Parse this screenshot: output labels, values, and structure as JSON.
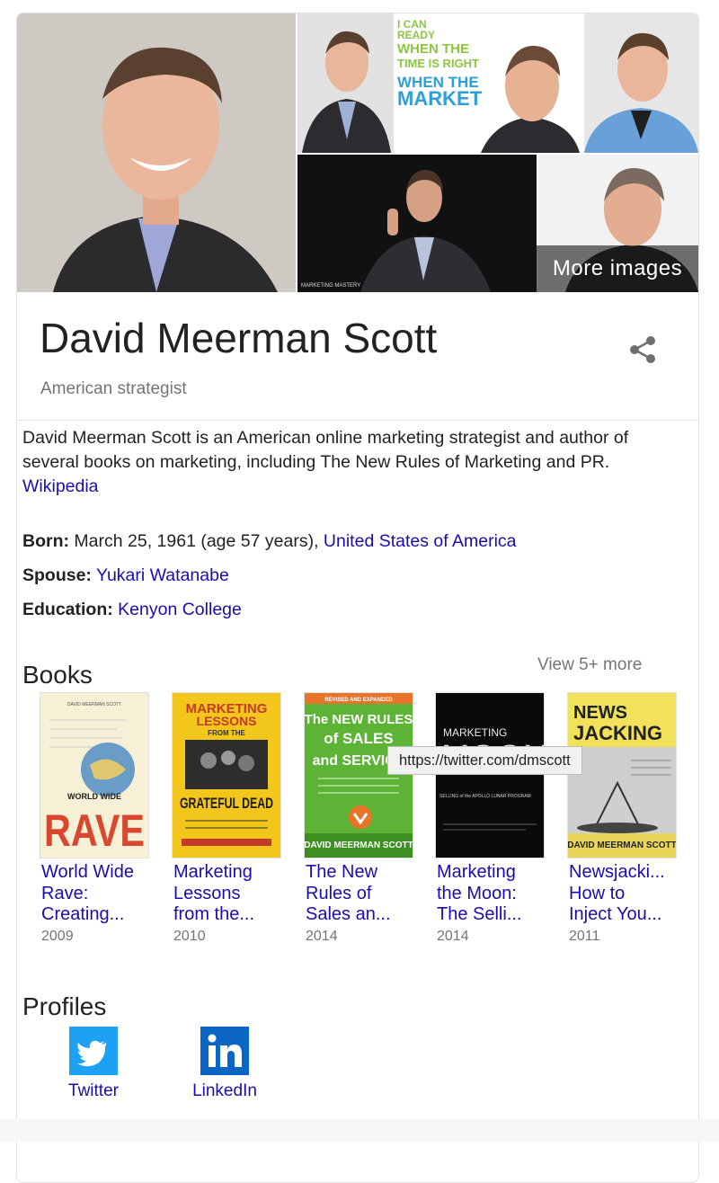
{
  "gallery": {
    "more_images_label": "More images",
    "thumb_text_lines": [
      "I CAN",
      "READY",
      "WHEN THE",
      "TIME IS RIGHT",
      "WHEN THE",
      "MARKET"
    ],
    "thumb_badge": "MARKETING MASTERY"
  },
  "entity": {
    "name": "David Meerman Scott",
    "subtitle": "American strategist"
  },
  "description": {
    "text": "David Meerman Scott is an American online marketing strategist and author of several books on marketing, including The New Rules of Marketing and PR.",
    "source_link": "Wikipedia"
  },
  "facts": {
    "born_label": "Born:",
    "born_value": "March 25, 1961 (age 57 years),",
    "born_place": "United States of America",
    "spouse_label": "Spouse:",
    "spouse_value": "Yukari Watanabe",
    "education_label": "Education:",
    "education_value": "Kenyon College"
  },
  "books": {
    "heading": "Books",
    "view_more": "View 5+ more",
    "items": [
      {
        "title": "World Wide\nRave:\nCreating...",
        "year": "2009",
        "cover": {
          "top_line": "DAVID MEERMAN SCOTT",
          "line1": "WORLD WIDE",
          "line2": "RAVE"
        }
      },
      {
        "title": "Marketing\nLessons\nfrom the...",
        "year": "2010",
        "cover": {
          "line1": "MARKETING",
          "line2": "LESSONS",
          "line3": "FROM THE",
          "line4": "GRATEFUL DEAD"
        }
      },
      {
        "title": "The New\nRules of\nSales an...",
        "year": "2014",
        "cover": {
          "top_line": "REVISED AND EXPANDED",
          "line1": "The NEW RULES",
          "line2": "of SALES",
          "line3": "and SERVICE",
          "author": "DAVID MEERMAN SCOTT"
        }
      },
      {
        "title": "Marketing\nthe Moon:\nThe Selli...",
        "year": "2014",
        "cover": {
          "line1": "MARKETING",
          "line2": "MOON",
          "line3": "SELLING of the APOLLO LUNAR PROGRAM"
        }
      },
      {
        "title": "Newsjacki...\nHow to\nInject You...",
        "year": "2011",
        "cover": {
          "line1": "NEWS",
          "line2": "JACKING",
          "author": "DAVID MEERMAN SCOTT"
        }
      }
    ]
  },
  "tooltip": {
    "text": "https://twitter.com/dmscott"
  },
  "profiles": {
    "heading": "Profiles",
    "items": [
      {
        "label": "Twitter",
        "color": "#1da1f2"
      },
      {
        "label": "LinkedIn",
        "color": "#0a66c2"
      }
    ]
  }
}
